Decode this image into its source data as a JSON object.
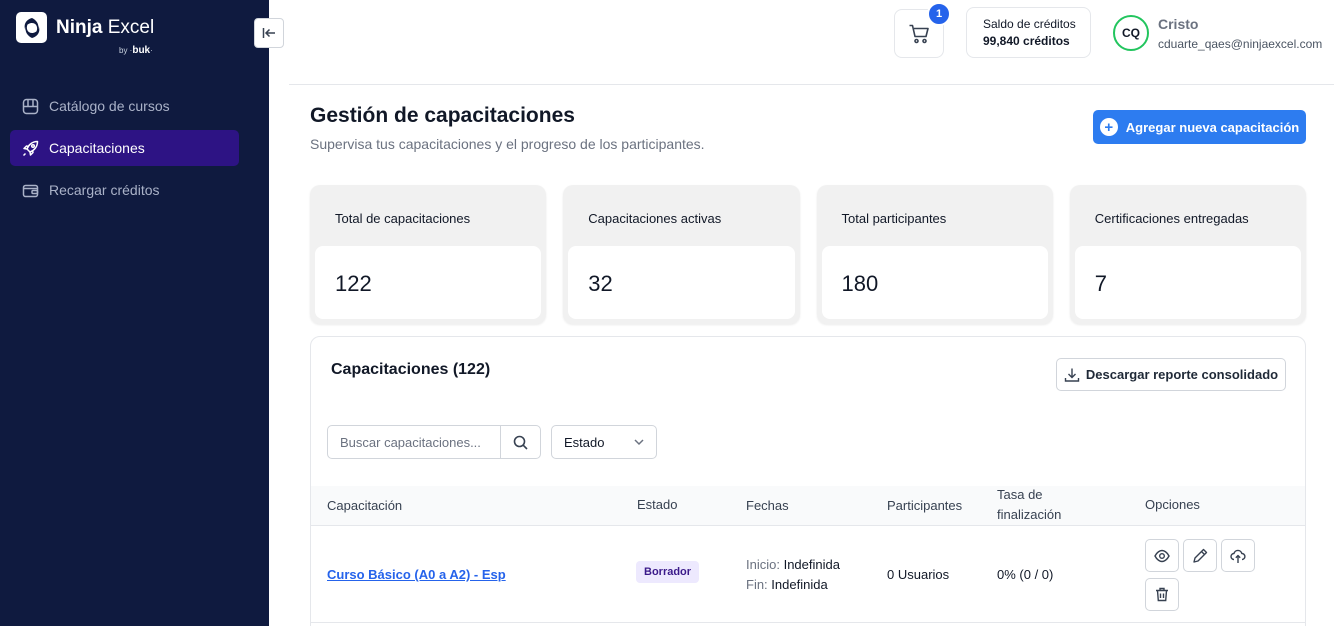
{
  "brand": {
    "name_bold": "Ninja",
    "name_light": " Excel",
    "by": "by",
    "sub_brand": "buk"
  },
  "sidebar": {
    "items": [
      {
        "label": "Catálogo de cursos",
        "icon": "catalog-icon",
        "active": false
      },
      {
        "label": "Capacitaciones",
        "icon": "rocket-icon",
        "active": true
      },
      {
        "label": "Recargar créditos",
        "icon": "wallet-icon",
        "active": false
      }
    ]
  },
  "header": {
    "cart_count": "1",
    "credits_label": "Saldo de créditos",
    "credits_value": "99,840 créditos",
    "avatar_initials": "CQ",
    "user_name": "Cristo",
    "user_email": "cduarte_qaes@ninjaexcel.com"
  },
  "page": {
    "title": "Gestión de capacitaciones",
    "subtitle": "Supervisa tus capacitaciones y el progreso de los participantes.",
    "add_button": "Agregar nueva capacitación"
  },
  "stats": [
    {
      "label": "Total de capacitaciones",
      "value": "122"
    },
    {
      "label": "Capacitaciones activas",
      "value": "32"
    },
    {
      "label": "Total participantes",
      "value": "180"
    },
    {
      "label": "Certificaciones entregadas",
      "value": "7"
    }
  ],
  "panel": {
    "title": "Capacitaciones (122)",
    "download_button": "Descargar reporte consolidado",
    "search_placeholder": "Buscar capacitaciones...",
    "status_select": "Estado"
  },
  "table": {
    "columns": {
      "course": "Capacitación",
      "status": "Estado",
      "dates": "Fechas",
      "participants": "Participantes",
      "completion_l1": "Tasa de",
      "completion_l2": "finalización",
      "options": "Opciones"
    },
    "rows": [
      {
        "course": "Curso Básico (A0 a A2) - Esp",
        "status": "Borrador",
        "start_label": "Inicio:",
        "start_value": "Indefinida",
        "end_label": "Fin:",
        "end_value": "Indefinida",
        "participants": "0 Usuarios",
        "completion": "0% (0 / 0)"
      }
    ]
  },
  "colors": {
    "sidebar_bg": "#0f1a3f",
    "sidebar_active": "#2d1384",
    "primary": "#2d7cf0",
    "avatar_ring": "#22c55e"
  }
}
